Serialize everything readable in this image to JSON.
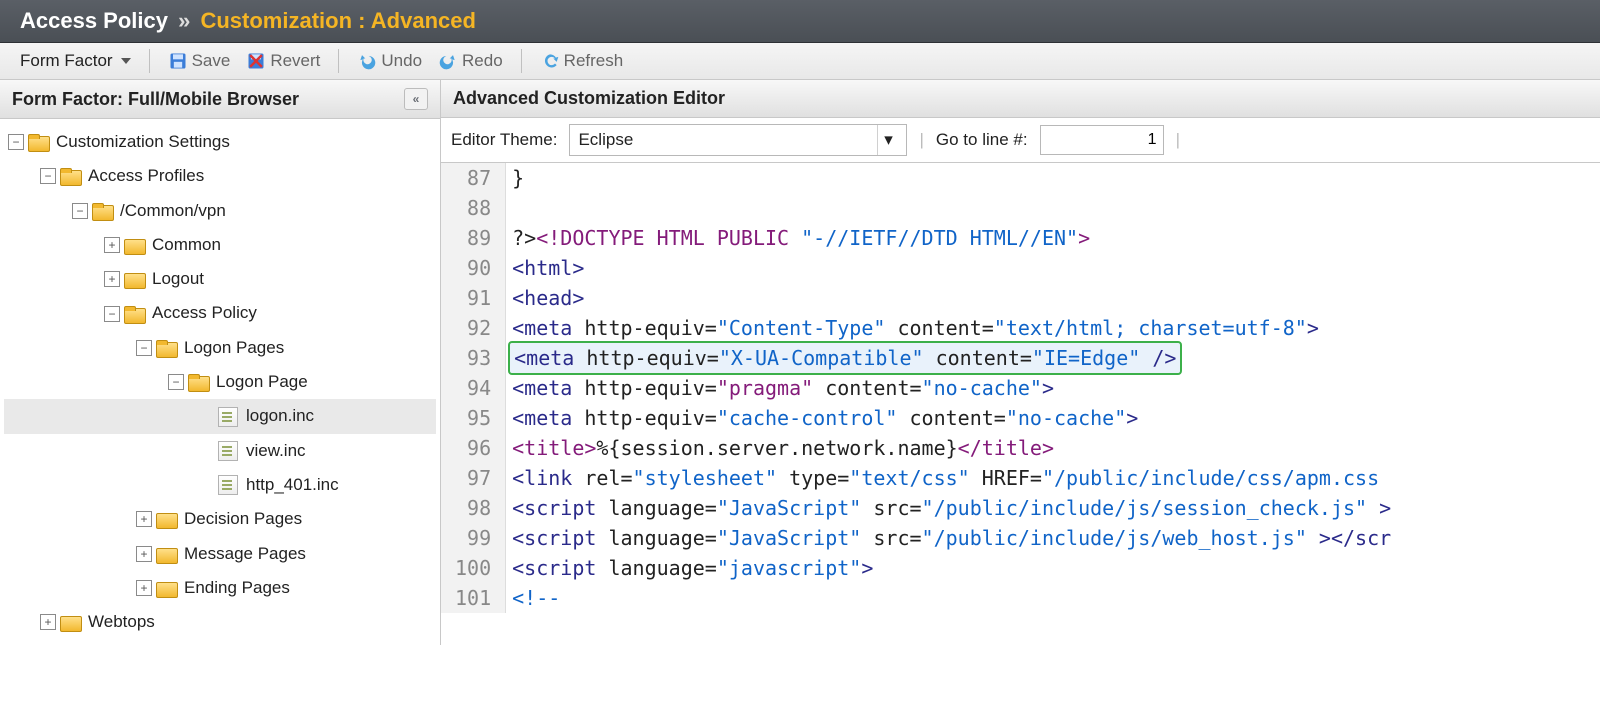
{
  "breadcrumb": {
    "root": "Access Policy",
    "sep": "»",
    "current": "Customization : Advanced"
  },
  "toolbar": {
    "form_factor": "Form Factor",
    "save": "Save",
    "revert": "Revert",
    "undo": "Undo",
    "redo": "Redo",
    "refresh": "Refresh"
  },
  "left_panel": {
    "title": "Form Factor: Full/Mobile Browser"
  },
  "tree": [
    {
      "depth": 0,
      "exp": "-",
      "icon": "folder-open",
      "label": "Customization Settings"
    },
    {
      "depth": 1,
      "exp": "-",
      "icon": "folder-open",
      "label": "Access Profiles"
    },
    {
      "depth": 2,
      "exp": "-",
      "icon": "folder-open",
      "label": "/Common/vpn"
    },
    {
      "depth": 3,
      "exp": "+",
      "icon": "folder",
      "label": "Common"
    },
    {
      "depth": 3,
      "exp": "+",
      "icon": "folder",
      "label": "Logout"
    },
    {
      "depth": 3,
      "exp": "-",
      "icon": "folder-open",
      "label": "Access Policy"
    },
    {
      "depth": 4,
      "exp": "-",
      "icon": "folder-open",
      "label": "Logon Pages"
    },
    {
      "depth": 5,
      "exp": "-",
      "icon": "folder-open",
      "label": "Logon Page"
    },
    {
      "depth": 6,
      "exp": " ",
      "icon": "file",
      "label": "logon.inc",
      "selected": true
    },
    {
      "depth": 6,
      "exp": " ",
      "icon": "file",
      "label": "view.inc"
    },
    {
      "depth": 6,
      "exp": " ",
      "icon": "file",
      "label": "http_401.inc"
    },
    {
      "depth": 4,
      "exp": "+",
      "icon": "folder",
      "label": "Decision Pages"
    },
    {
      "depth": 4,
      "exp": "+",
      "icon": "folder",
      "label": "Message Pages"
    },
    {
      "depth": 4,
      "exp": "+",
      "icon": "folder",
      "label": "Ending Pages"
    },
    {
      "depth": 1,
      "exp": "+",
      "icon": "folder",
      "label": "Webtops"
    }
  ],
  "editor": {
    "title": "Advanced Customization Editor",
    "theme_label": "Editor Theme:",
    "theme_value": "Eclipse",
    "goto_label": "Go to line #:",
    "goto_value": "1",
    "first_line_no": 87,
    "code_lines": [
      {
        "tokens": [
          {
            "c": "pun",
            "t": "}"
          }
        ]
      },
      {
        "tokens": []
      },
      {
        "tokens": [
          {
            "c": "pun",
            "t": "?>"
          },
          {
            "c": "doctype",
            "t": "<!DOCTYPE HTML PUBLIC "
          },
          {
            "c": "str",
            "t": "\"-//IETF//DTD HTML//EN\""
          },
          {
            "c": "doctype",
            "t": ">"
          }
        ]
      },
      {
        "tokens": [
          {
            "c": "tag",
            "t": "<html>"
          }
        ]
      },
      {
        "tokens": [
          {
            "c": "tag",
            "t": "<head>"
          }
        ]
      },
      {
        "tokens": [
          {
            "c": "tag",
            "t": "<meta "
          },
          {
            "c": "attr",
            "t": "http-equiv="
          },
          {
            "c": "str",
            "t": "\"Content-Type\""
          },
          {
            "c": "attr",
            "t": " content="
          },
          {
            "c": "str",
            "t": "\"text/html; charset=utf-8\""
          },
          {
            "c": "tag",
            "t": ">"
          }
        ]
      },
      {
        "highlight": true,
        "tokens": [
          {
            "c": "tag",
            "t": "<meta "
          },
          {
            "c": "attr",
            "t": "http-equiv="
          },
          {
            "c": "str",
            "t": "\"X-UA-Compatible\""
          },
          {
            "c": "attr",
            "t": " content="
          },
          {
            "c": "str",
            "t": "\"IE=Edge\""
          },
          {
            "c": "tag",
            "t": " />"
          }
        ]
      },
      {
        "tokens": [
          {
            "c": "tag",
            "t": "<meta "
          },
          {
            "c": "attr",
            "t": "http-equiv="
          },
          {
            "c": "prag",
            "t": "\"pragma\""
          },
          {
            "c": "attr",
            "t": " content="
          },
          {
            "c": "str",
            "t": "\"no-cache\""
          },
          {
            "c": "tag",
            "t": ">"
          }
        ]
      },
      {
        "tokens": [
          {
            "c": "tag",
            "t": "<meta "
          },
          {
            "c": "attr",
            "t": "http-equiv="
          },
          {
            "c": "str",
            "t": "\"cache-control\""
          },
          {
            "c": "attr",
            "t": " content="
          },
          {
            "c": "str",
            "t": "\"no-cache\""
          },
          {
            "c": "tag",
            "t": ">"
          }
        ]
      },
      {
        "tokens": [
          {
            "c": "title",
            "t": "<title>"
          },
          {
            "c": "pun",
            "t": "%{session.server.network.name}"
          },
          {
            "c": "title",
            "t": "</title>"
          }
        ]
      },
      {
        "tokens": [
          {
            "c": "tag",
            "t": "<link "
          },
          {
            "c": "attr",
            "t": "rel="
          },
          {
            "c": "str",
            "t": "\"stylesheet\""
          },
          {
            "c": "attr",
            "t": " type="
          },
          {
            "c": "str",
            "t": "\"text/css\""
          },
          {
            "c": "attr",
            "t": " HREF="
          },
          {
            "c": "str",
            "t": "\"/public/include/css/apm.css"
          }
        ]
      },
      {
        "tokens": [
          {
            "c": "tag",
            "t": "<script "
          },
          {
            "c": "attr",
            "t": "language="
          },
          {
            "c": "str",
            "t": "\"JavaScript\""
          },
          {
            "c": "attr",
            "t": " src="
          },
          {
            "c": "str",
            "t": "\"/public/include/js/session_check.js\""
          },
          {
            "c": "tag",
            "t": " >"
          }
        ]
      },
      {
        "tokens": [
          {
            "c": "tag",
            "t": "<script "
          },
          {
            "c": "attr",
            "t": "language="
          },
          {
            "c": "str",
            "t": "\"JavaScript\""
          },
          {
            "c": "attr",
            "t": " src="
          },
          {
            "c": "str",
            "t": "\"/public/include/js/web_host.js\""
          },
          {
            "c": "tag",
            "t": " >"
          },
          {
            "c": "tag",
            "t": "</scr"
          }
        ]
      },
      {
        "tokens": [
          {
            "c": "tag",
            "t": "<script "
          },
          {
            "c": "attr",
            "t": "language="
          },
          {
            "c": "str",
            "t": "\"javascript\""
          },
          {
            "c": "tag",
            "t": ">"
          }
        ]
      },
      {
        "tokens": [
          {
            "c": "cmt",
            "t": "<!--"
          }
        ]
      }
    ]
  },
  "icons": {
    "save": "save-icon",
    "revert": "revert-icon",
    "undo": "undo-icon",
    "redo": "redo-icon",
    "refresh": "refresh-icon"
  }
}
